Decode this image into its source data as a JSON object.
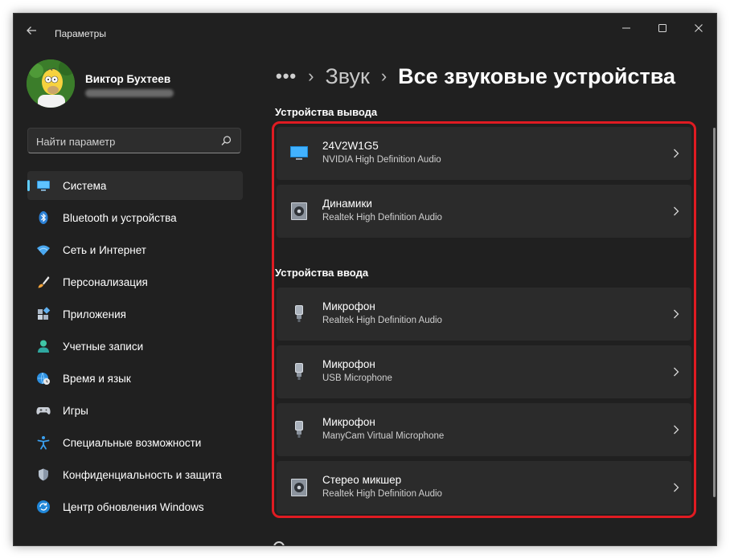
{
  "window": {
    "title": "Параметры",
    "controls": [
      "minimize-icon",
      "maximize-icon",
      "close-icon"
    ]
  },
  "profile": {
    "name": "Виктор Бухтеев",
    "avatar_icon": "homer-avatar"
  },
  "search": {
    "placeholder": "Найти параметр",
    "value": ""
  },
  "sidebar": {
    "items": [
      {
        "label": "Система",
        "icon": "monitor-icon",
        "active": true
      },
      {
        "label": "Bluetooth и устройства",
        "icon": "bluetooth-icon",
        "active": false
      },
      {
        "label": "Сеть и Интернет",
        "icon": "wifi-icon",
        "active": false
      },
      {
        "label": "Персонализация",
        "icon": "brush-icon",
        "active": false
      },
      {
        "label": "Приложения",
        "icon": "apps-icon",
        "active": false
      },
      {
        "label": "Учетные записи",
        "icon": "person-icon",
        "active": false
      },
      {
        "label": "Время и язык",
        "icon": "globe-clock-icon",
        "active": false
      },
      {
        "label": "Игры",
        "icon": "gamepad-icon",
        "active": false
      },
      {
        "label": "Специальные возможности",
        "icon": "accessibility-icon",
        "active": false
      },
      {
        "label": "Конфиденциальность и защита",
        "icon": "shield-icon",
        "active": false
      },
      {
        "label": "Центр обновления Windows",
        "icon": "update-icon",
        "active": false
      }
    ]
  },
  "breadcrumb": {
    "more": "•••",
    "parent": "Звук",
    "current": "Все звуковые устройства",
    "separator": "›"
  },
  "output": {
    "title": "Устройства вывода",
    "devices": [
      {
        "name": "24V2W1G5",
        "sub": "NVIDIA High Definition Audio",
        "icon": "monitor-device-icon"
      },
      {
        "name": "Динамики",
        "sub": "Realtek High Definition Audio",
        "icon": "speaker-icon"
      }
    ]
  },
  "input": {
    "title": "Устройства ввода",
    "devices": [
      {
        "name": "Микрофон",
        "sub": "Realtek High Definition Audio",
        "icon": "microphone-icon"
      },
      {
        "name": "Микрофон",
        "sub": "USB Microphone",
        "icon": "microphone-icon"
      },
      {
        "name": "Микрофон",
        "sub": "ManyCam Virtual Microphone",
        "icon": "microphone-icon"
      },
      {
        "name": "Стерео микшер",
        "sub": "Realtek High Definition Audio",
        "icon": "speaker-icon"
      }
    ]
  },
  "colors": {
    "background": "#202020",
    "card": "#2b2b2b",
    "accent": "#60cdff",
    "highlight": "#e01b22"
  }
}
